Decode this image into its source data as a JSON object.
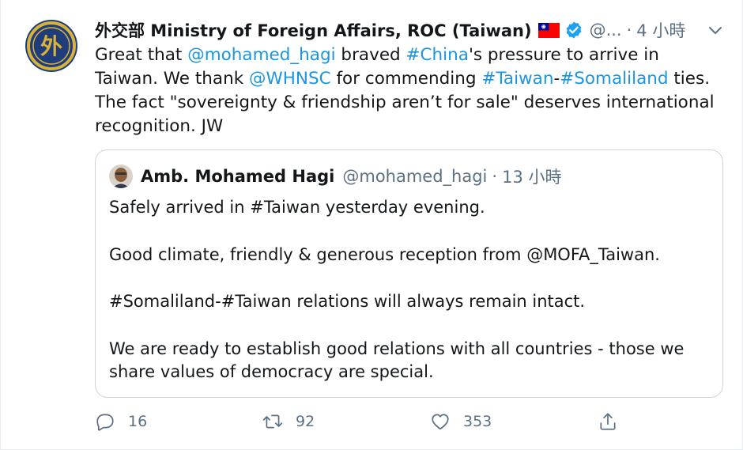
{
  "tweet": {
    "display_name": "外交部 Ministry of Foreign Affairs, ROC (Taiwan)",
    "handle": "@...",
    "time": "4 小時",
    "flag_icon": "taiwan-flag-icon",
    "verified_icon": "verified-badge-icon",
    "body": {
      "t1": "Great that ",
      "link1": "@mohamed_hagi",
      "t2": " braved ",
      "link2": "#China",
      "t3": "'s pressure to arrive in Taiwan. We thank ",
      "link3": "@WHNSC",
      "t4": " for commending ",
      "link4": "#Taiwan",
      "t5": "-",
      "link5": "#Somaliland",
      "t6": " ties. The fact \"sovereignty & friendship aren’t for sale\" deserves international recognition. JW"
    },
    "colors": {
      "link": "#1b95e0",
      "muted": "#5b7083",
      "border": "#ccd6dd"
    }
  },
  "quote": {
    "display_name": "Amb. Mohamed Hagi",
    "handle": "@mohamed_hagi",
    "time": "13 小時",
    "paragraphs": [
      "Safely arrived in #Taiwan yesterday evening.",
      "Good climate, friendly & generous reception from @MOFA_Taiwan.",
      "#Somaliland-#Taiwan relations will always remain intact.",
      "We are ready to establish good relations with all countries - those we share values of democracy are special."
    ]
  },
  "actions": {
    "reply_count": "16",
    "retweet_count": "92",
    "like_count": "353"
  }
}
